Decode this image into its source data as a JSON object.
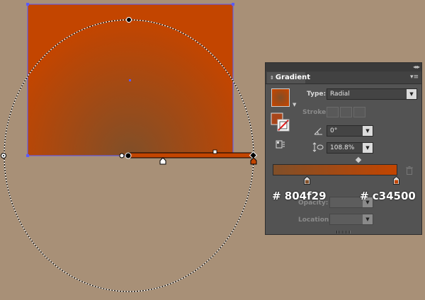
{
  "panel": {
    "title": "Gradient",
    "type_label": "Type:",
    "type_value": "Radial",
    "stroke_label": "Stroke:",
    "angle_value": "0°",
    "aspect_value": "108.8%",
    "opacity_label": "Opacity:",
    "location_label": "Location:"
  },
  "annotations": {
    "left_color": "# 804f29",
    "right_color": "# c34500"
  },
  "colors": {
    "start": "#804f29",
    "end": "#c34500",
    "background": "#a89077",
    "selection": "#5a5aff"
  },
  "icons": {
    "panel_collapse": "double-chevron-left-icon",
    "panel_close": "close-icon",
    "panel_menu": "panel-menu-icon",
    "angle": "angle-icon",
    "aspect_ratio": "aspect-ratio-icon",
    "reverse": "reverse-gradient-icon",
    "delete_stop": "trash-icon"
  }
}
